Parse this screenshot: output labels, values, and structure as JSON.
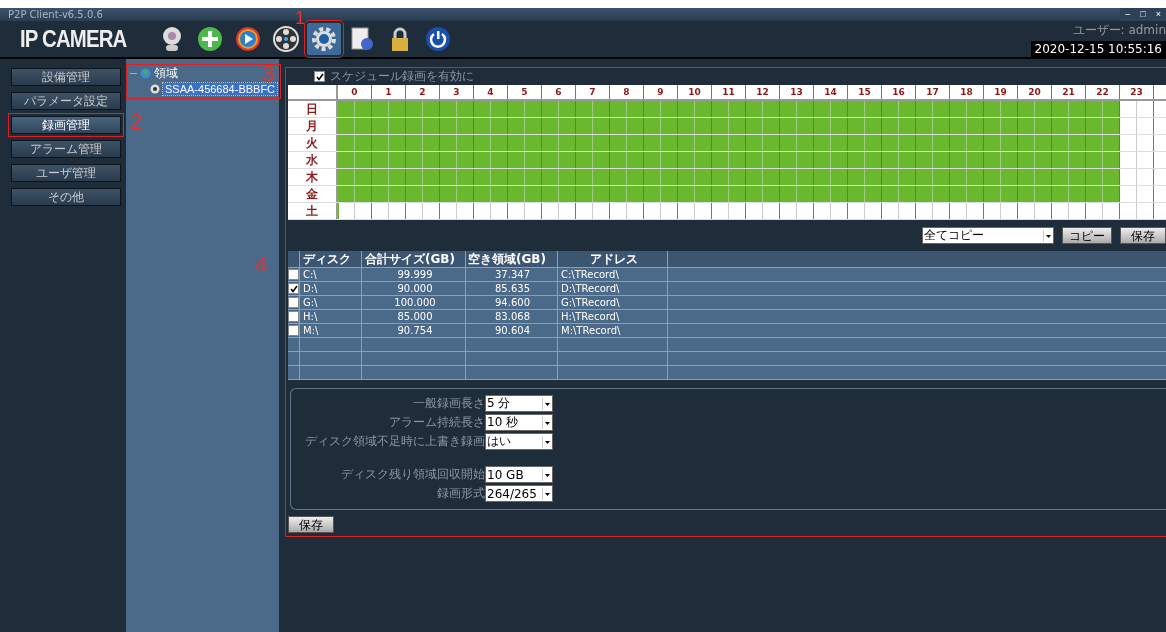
{
  "window": {
    "title": "P2P Client-v6.5.0.6",
    "logo": "IP CAMERA",
    "controls": [
      "–",
      "□",
      "×"
    ]
  },
  "toolbar": [
    {
      "kind": "webcam",
      "selected": false
    },
    {
      "kind": "add",
      "selected": false
    },
    {
      "kind": "play",
      "selected": false
    },
    {
      "kind": "reel",
      "selected": false
    },
    {
      "kind": "gear",
      "selected": true,
      "callout": "1"
    },
    {
      "kind": "document",
      "selected": false
    },
    {
      "kind": "lock",
      "selected": false
    },
    {
      "kind": "power",
      "selected": false
    }
  ],
  "user": "ユーザー: admin",
  "datetime": "2020-12-15  10:55:16",
  "sidebar": {
    "items": [
      {
        "label": "設備管理",
        "selected": false
      },
      {
        "label": "パラメータ設定",
        "selected": false
      },
      {
        "label": "録画管理",
        "selected": true,
        "callout": "2"
      },
      {
        "label": "アラーム管理",
        "selected": false
      },
      {
        "label": "ユーザ管理",
        "selected": false
      },
      {
        "label": "その他",
        "selected": false
      }
    ]
  },
  "tree": {
    "callout": "3",
    "expanded": true,
    "label": "領域",
    "children": [
      {
        "label": "SSAA-456684-BBBFC",
        "selected": true
      }
    ]
  },
  "main": {
    "callout": "4",
    "schedule_enabled": {
      "label": "スケジュール録画を有効に",
      "checked": true
    },
    "hours": [
      "0",
      "1",
      "2",
      "3",
      "4",
      "5",
      "6",
      "7",
      "8",
      "9",
      "10",
      "11",
      "12",
      "13",
      "14",
      "15",
      "16",
      "17",
      "18",
      "19",
      "20",
      "21",
      "22",
      "23"
    ],
    "days": [
      {
        "label": "日",
        "level": 0.9583
      },
      {
        "label": "月",
        "level": 0.9583
      },
      {
        "label": "火",
        "level": 0.9583
      },
      {
        "label": "水",
        "level": 0.9583
      },
      {
        "label": "木",
        "level": 0.9583
      },
      {
        "label": "金",
        "level": 0.9583
      },
      {
        "label": "土",
        "level": 0
      }
    ],
    "copy_select": "全てコピー",
    "copy_button": "コピー",
    "save_top": "保存",
    "disk_table": {
      "columns": [
        "ディスク",
        "合計サイズ(GB)",
        "空き領域(GB)",
        "アドレス"
      ],
      "rows": [
        {
          "checked": false,
          "cells": [
            "C:\\",
            "99.999",
            "37.347",
            "C:\\TRecord\\"
          ]
        },
        {
          "checked": true,
          "cells": [
            "D:\\",
            "90.000",
            "85.635",
            "D:\\TRecord\\"
          ]
        },
        {
          "checked": false,
          "cells": [
            "G:\\",
            "100.000",
            "94.600",
            "G:\\TRecord\\"
          ]
        },
        {
          "checked": false,
          "cells": [
            "H:\\",
            "85.000",
            "83.068",
            "H:\\TRecord\\"
          ]
        },
        {
          "checked": false,
          "cells": [
            "M:\\",
            "90.754",
            "90.604",
            "M:\\TRecord\\"
          ]
        }
      ]
    },
    "settings": [
      {
        "items": [
          {
            "label": "一般録画長さ",
            "value": "5 分"
          },
          {
            "label": "アラーム持続長さ",
            "value": "10 秒"
          },
          {
            "label": "ディスク領域不足時に上書き録画",
            "value": "はい"
          }
        ]
      },
      {
        "items": [
          {
            "label": "ディスク残り領域回収開始",
            "value": "10 GB"
          },
          {
            "label": "録画形式",
            "value": "264/265"
          }
        ]
      }
    ],
    "save_bottom": "保存"
  }
}
